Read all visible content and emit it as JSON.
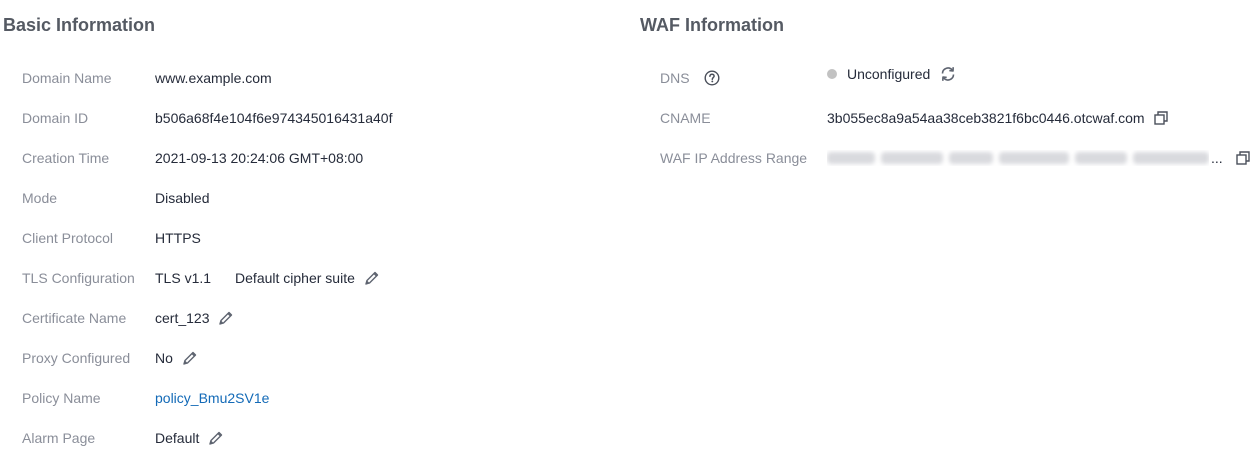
{
  "basic": {
    "title": "Basic Information",
    "domain_name": {
      "label": "Domain Name",
      "value": "www.example.com"
    },
    "domain_id": {
      "label": "Domain ID",
      "value": "b506a68f4e104f6e974345016431a40f"
    },
    "creation_time": {
      "label": "Creation Time",
      "value": "2021-09-13 20:24:06 GMT+08:00"
    },
    "mode": {
      "label": "Mode",
      "value": "Disabled"
    },
    "client_protocol": {
      "label": "Client Protocol",
      "value": "HTTPS"
    },
    "tls": {
      "label": "TLS Configuration",
      "version": "TLS v1.1",
      "cipher": "Default cipher suite",
      "icon": "edit-icon"
    },
    "certificate": {
      "label": "Certificate Name",
      "value": "cert_123",
      "icon": "edit-icon"
    },
    "proxy": {
      "label": "Proxy Configured",
      "value": "No",
      "icon": "edit-icon"
    },
    "policy": {
      "label": "Policy Name",
      "value": "policy_Bmu2SV1e"
    },
    "alarm_page": {
      "label": "Alarm Page",
      "value": "Default",
      "icon": "edit-icon"
    }
  },
  "waf": {
    "title": "WAF Information",
    "dns": {
      "label": "DNS",
      "status": "Unconfigured",
      "status_color": "#c2c2c2",
      "help_icon": "help-icon",
      "refresh_icon": "refresh-icon"
    },
    "cname": {
      "label": "CNAME",
      "value": "3b055ec8a9a54aa38ceb3821f6bc0446.otcwaf.com",
      "icon": "copy-icon"
    },
    "ip_range": {
      "label": "WAF IP Address Range",
      "ellipsis": "...",
      "icon": "copy-icon"
    }
  },
  "colors": {
    "label": "#8a8e99",
    "value": "#252b3a",
    "link": "#136ab7",
    "title": "#555a63"
  }
}
